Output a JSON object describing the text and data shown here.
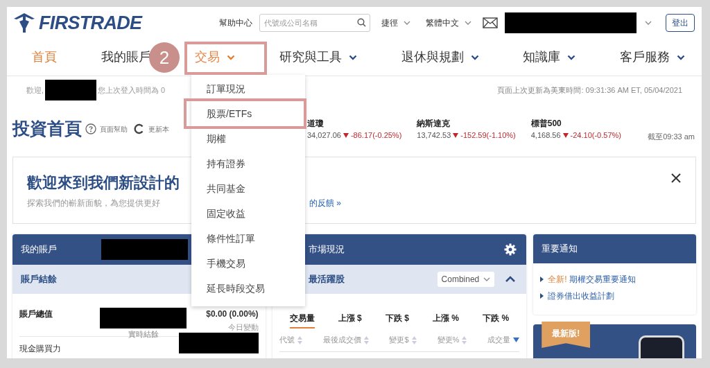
{
  "header": {
    "logo": "FIRSTRADE",
    "help": "幫助中心",
    "search": {
      "placeholder": "代號或公司名稱"
    },
    "menus": [
      {
        "label": "捷徑"
      },
      {
        "label": "繁體中文"
      }
    ],
    "logout": "登出"
  },
  "nav": [
    {
      "label": "首頁",
      "selected": true,
      "has_menu": false,
      "expanded": false
    },
    {
      "label": "我的賬戶",
      "selected": false,
      "has_menu": false,
      "expanded": false
    },
    {
      "label": "交易",
      "selected": false,
      "has_menu": true,
      "expanded": true
    },
    {
      "label": "研究與工具",
      "selected": false,
      "has_menu": true,
      "expanded": false
    },
    {
      "label": "退休與規劃",
      "selected": false,
      "has_menu": true,
      "expanded": false
    },
    {
      "label": "知識庫",
      "selected": false,
      "has_menu": true,
      "expanded": false
    },
    {
      "label": "客戶服務",
      "selected": false,
      "has_menu": true,
      "expanded": false
    }
  ],
  "annotation": {
    "step": "2"
  },
  "dropdown": [
    {
      "label": "訂單現況",
      "highlighted": false
    },
    {
      "label": "股票/ETFs",
      "highlighted": true
    },
    {
      "label": "期權",
      "highlighted": false
    },
    {
      "label": "持有證券",
      "highlighted": false
    },
    {
      "label": "共同基金",
      "highlighted": false
    },
    {
      "label": "固定收益",
      "highlighted": false
    },
    {
      "label": "條件性訂單",
      "highlighted": false
    },
    {
      "label": "手機交易",
      "highlighted": false
    },
    {
      "label": "延長時段交易",
      "highlighted": false
    }
  ],
  "welcome": {
    "greeting": "歡迎,",
    "last_login": "您上次登入時間為 0",
    "updated": "頁面上次更新為美東時間: 09:31:36 AM ET, 05/04/2021"
  },
  "page": {
    "title": "投資首頁",
    "help": "頁面幫助",
    "refresh": "更新本"
  },
  "indices": [
    {
      "name": "道瓊",
      "value": "34,027.06",
      "change": "-86.17(-0.25%)"
    },
    {
      "name": "納斯達克",
      "value": "13,742.53",
      "change": "-152.59(-1.10%)"
    },
    {
      "name": "標普500",
      "value": "4,168.56",
      "change": "-24.10(-0.57%)"
    }
  ],
  "indices_time": "截至09:33 am",
  "banner": {
    "title": "歡迎來到我們新設計的",
    "text": "探索我們的嶄新面貌，為您提供更好",
    "link": "的反饋 »"
  },
  "account": {
    "title": "我的賬戶",
    "section": "賬戶結餘",
    "rows": [
      {
        "label": "賬戶總值",
        "value": "$0.00 (0.00%)",
        "note": "今日變動",
        "sub": "實時結餘"
      },
      {
        "label": "現金購買力"
      }
    ]
  },
  "market": {
    "title": "市場現況",
    "section": "最活躍股",
    "select": "Combined",
    "tabs": [
      {
        "label": "交易量",
        "selected": true
      },
      {
        "label": "上漲 $",
        "selected": false
      },
      {
        "label": "下跌 $",
        "selected": false
      },
      {
        "label": "上漲 %",
        "selected": false
      },
      {
        "label": "下跌 %",
        "selected": false
      }
    ],
    "columns": [
      {
        "label": "代號",
        "sorted": false
      },
      {
        "label": "最後成交價",
        "sorted": false
      },
      {
        "label": "變更$",
        "sorted": false
      },
      {
        "label": "變更%",
        "sorted": false
      },
      {
        "label": "成交量",
        "sorted": true
      }
    ]
  },
  "notices": {
    "title": "重要通知",
    "items": [
      {
        "tag": "全新!",
        "text": "期權交易重要通知"
      },
      {
        "text": "證券借出收益計劃"
      }
    ]
  },
  "promo": {
    "ribbon": "最新版!"
  }
}
